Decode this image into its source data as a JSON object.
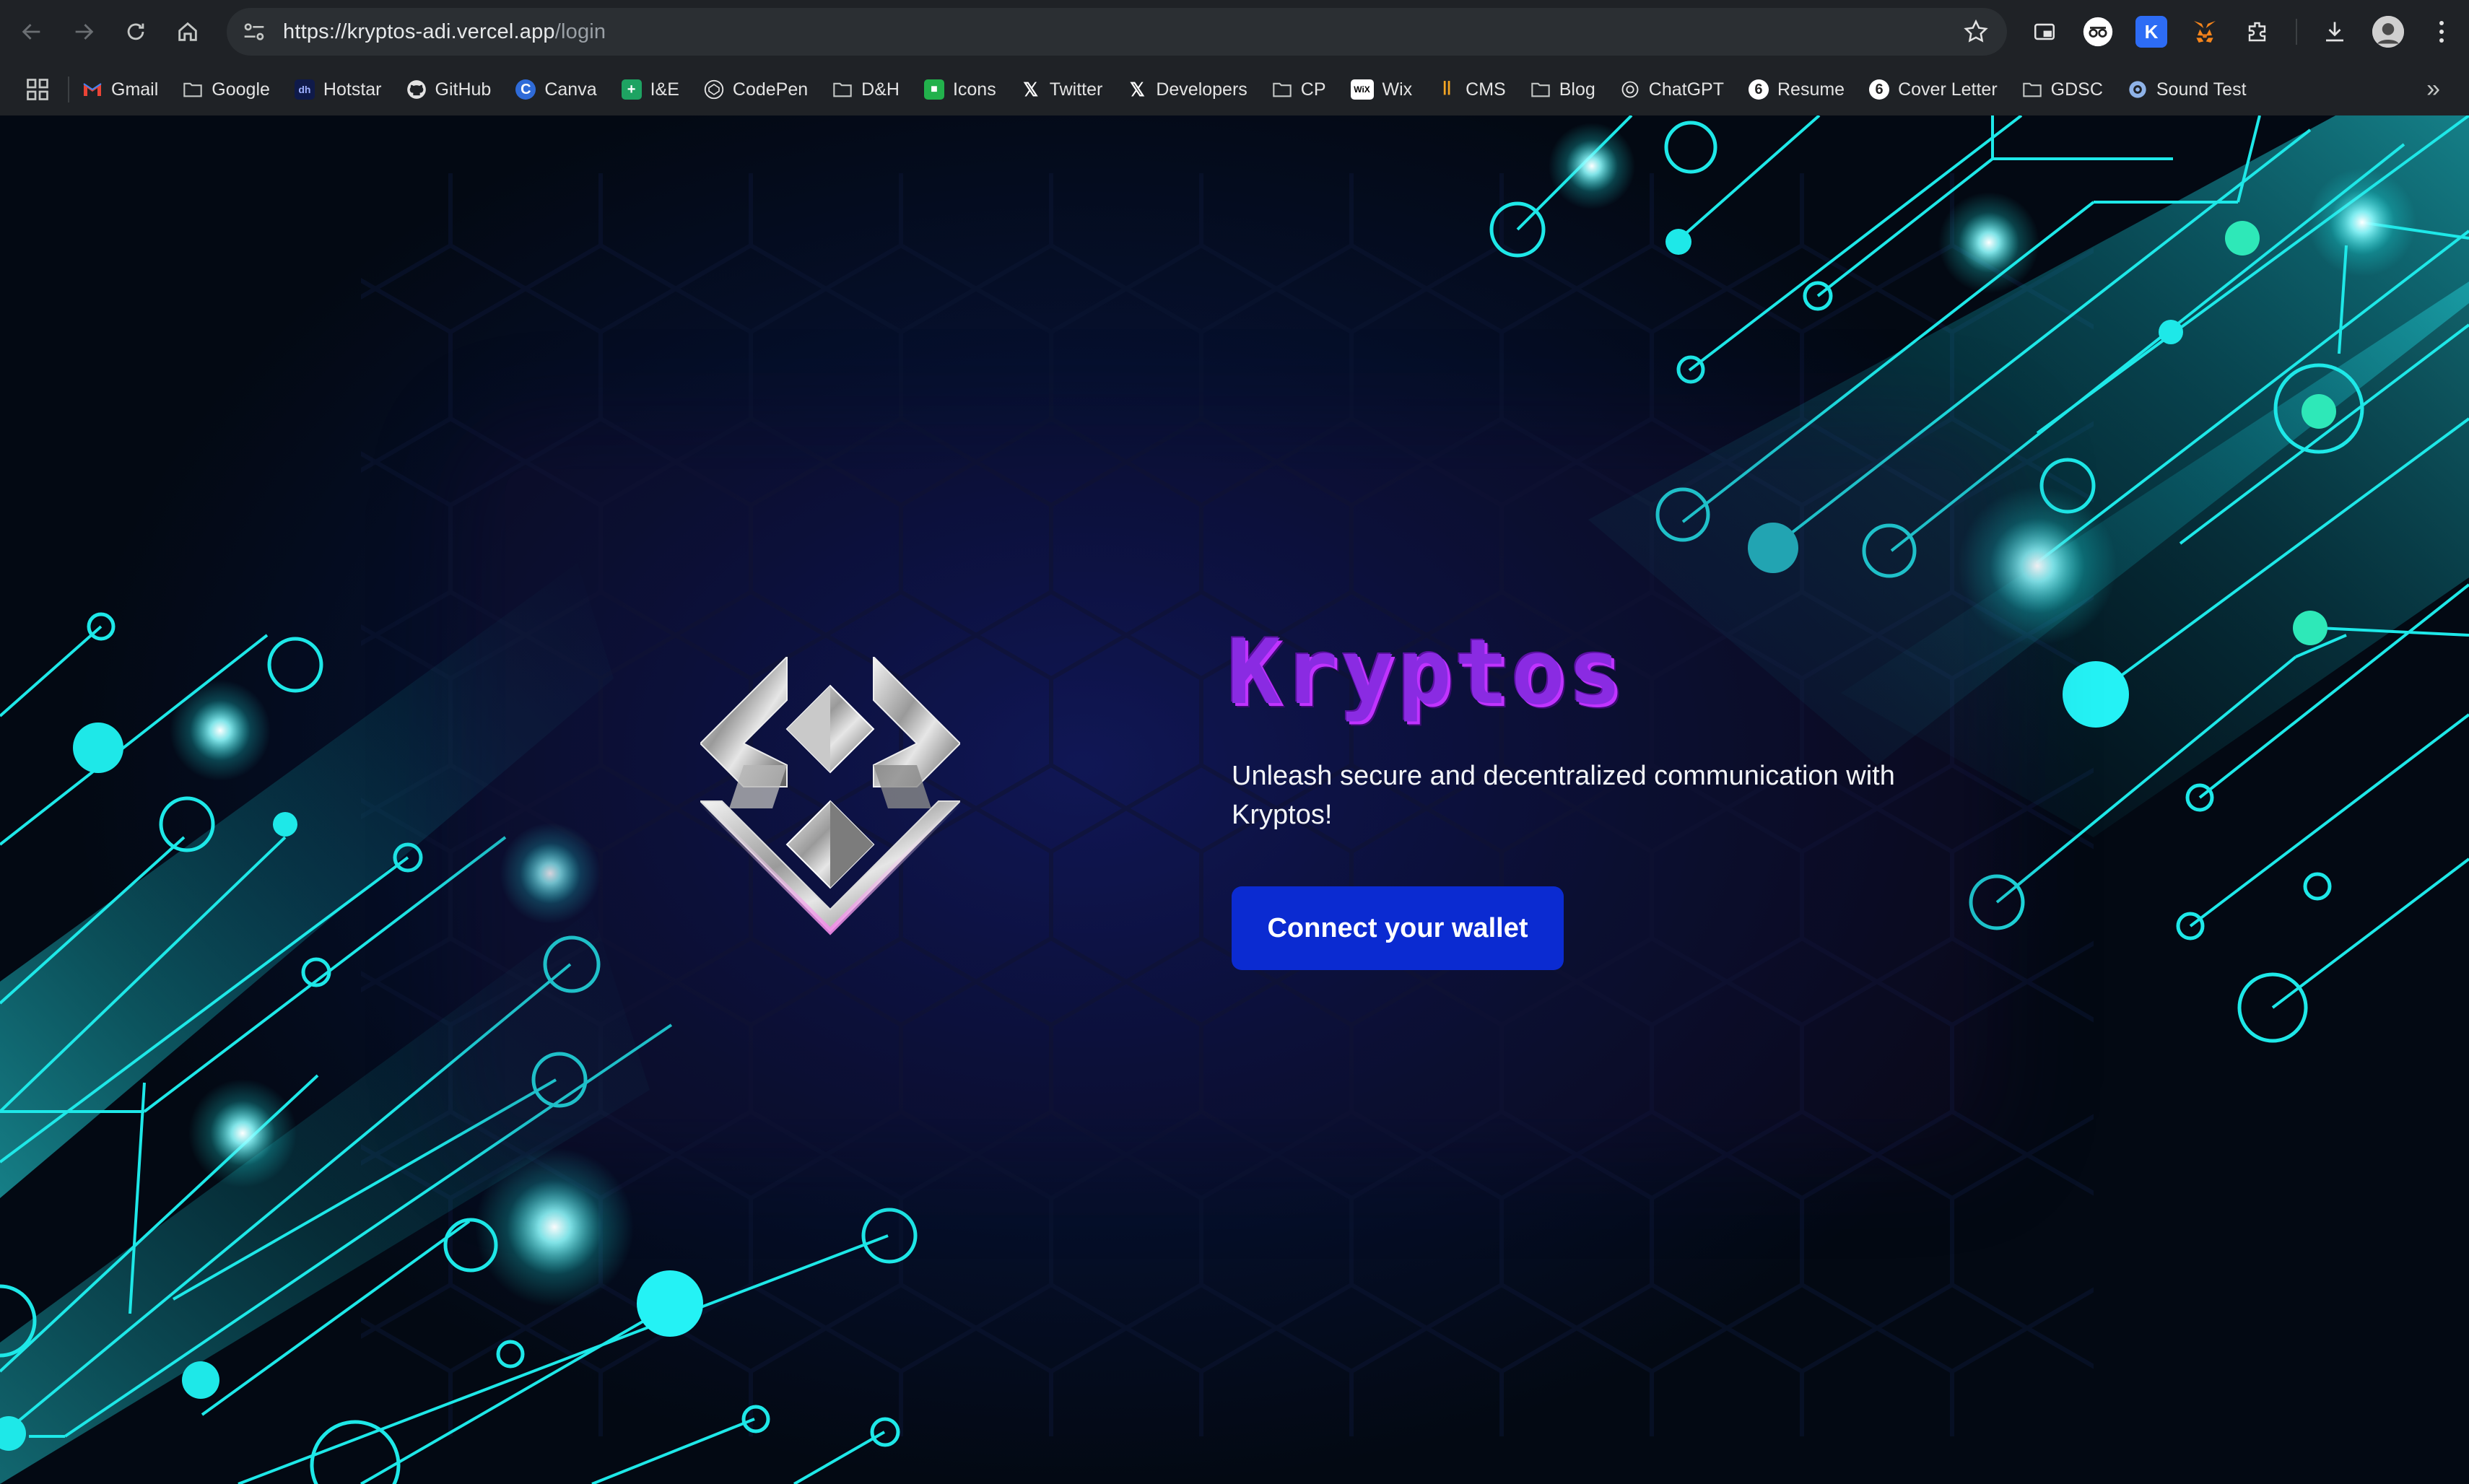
{
  "browser": {
    "url_host": "https://kryptos-adi.vercel.app",
    "url_path": "/login",
    "bookmarks": [
      {
        "label": "Gmail",
        "icon": "gmail-icon"
      },
      {
        "label": "Google",
        "icon": "folder-icon"
      },
      {
        "label": "Hotstar",
        "icon": "hotstar-icon"
      },
      {
        "label": "GitHub",
        "icon": "github-icon"
      },
      {
        "label": "Canva",
        "icon": "canva-icon"
      },
      {
        "label": "I&E",
        "icon": "sheets-icon"
      },
      {
        "label": "CodePen",
        "icon": "codepen-icon"
      },
      {
        "label": "D&H",
        "icon": "folder-icon"
      },
      {
        "label": "Icons",
        "icon": "icons-icon"
      },
      {
        "label": "Twitter",
        "icon": "x-icon"
      },
      {
        "label": "Developers",
        "icon": "x-icon"
      },
      {
        "label": "CP",
        "icon": "folder-icon"
      },
      {
        "label": "Wix",
        "icon": "wix-icon"
      },
      {
        "label": "CMS",
        "icon": "cms-icon"
      },
      {
        "label": "Blog",
        "icon": "folder-icon"
      },
      {
        "label": "ChatGPT",
        "icon": "chatgpt-icon"
      },
      {
        "label": "Resume",
        "icon": "resume-icon"
      },
      {
        "label": "Cover Letter",
        "icon": "resume-icon"
      },
      {
        "label": "GDSC",
        "icon": "folder-icon"
      },
      {
        "label": "Sound Test",
        "icon": "sound-test-icon"
      }
    ]
  },
  "main": {
    "brand": "Kryptos",
    "tagline": "Unleash secure and decentralized communication with Kryptos!",
    "cta_label": "Connect your wallet"
  },
  "colors": {
    "accent_button": "#0b2bd1",
    "brand_purple": "#8a2be2",
    "circuit_cyan": "#1ee8e8"
  }
}
